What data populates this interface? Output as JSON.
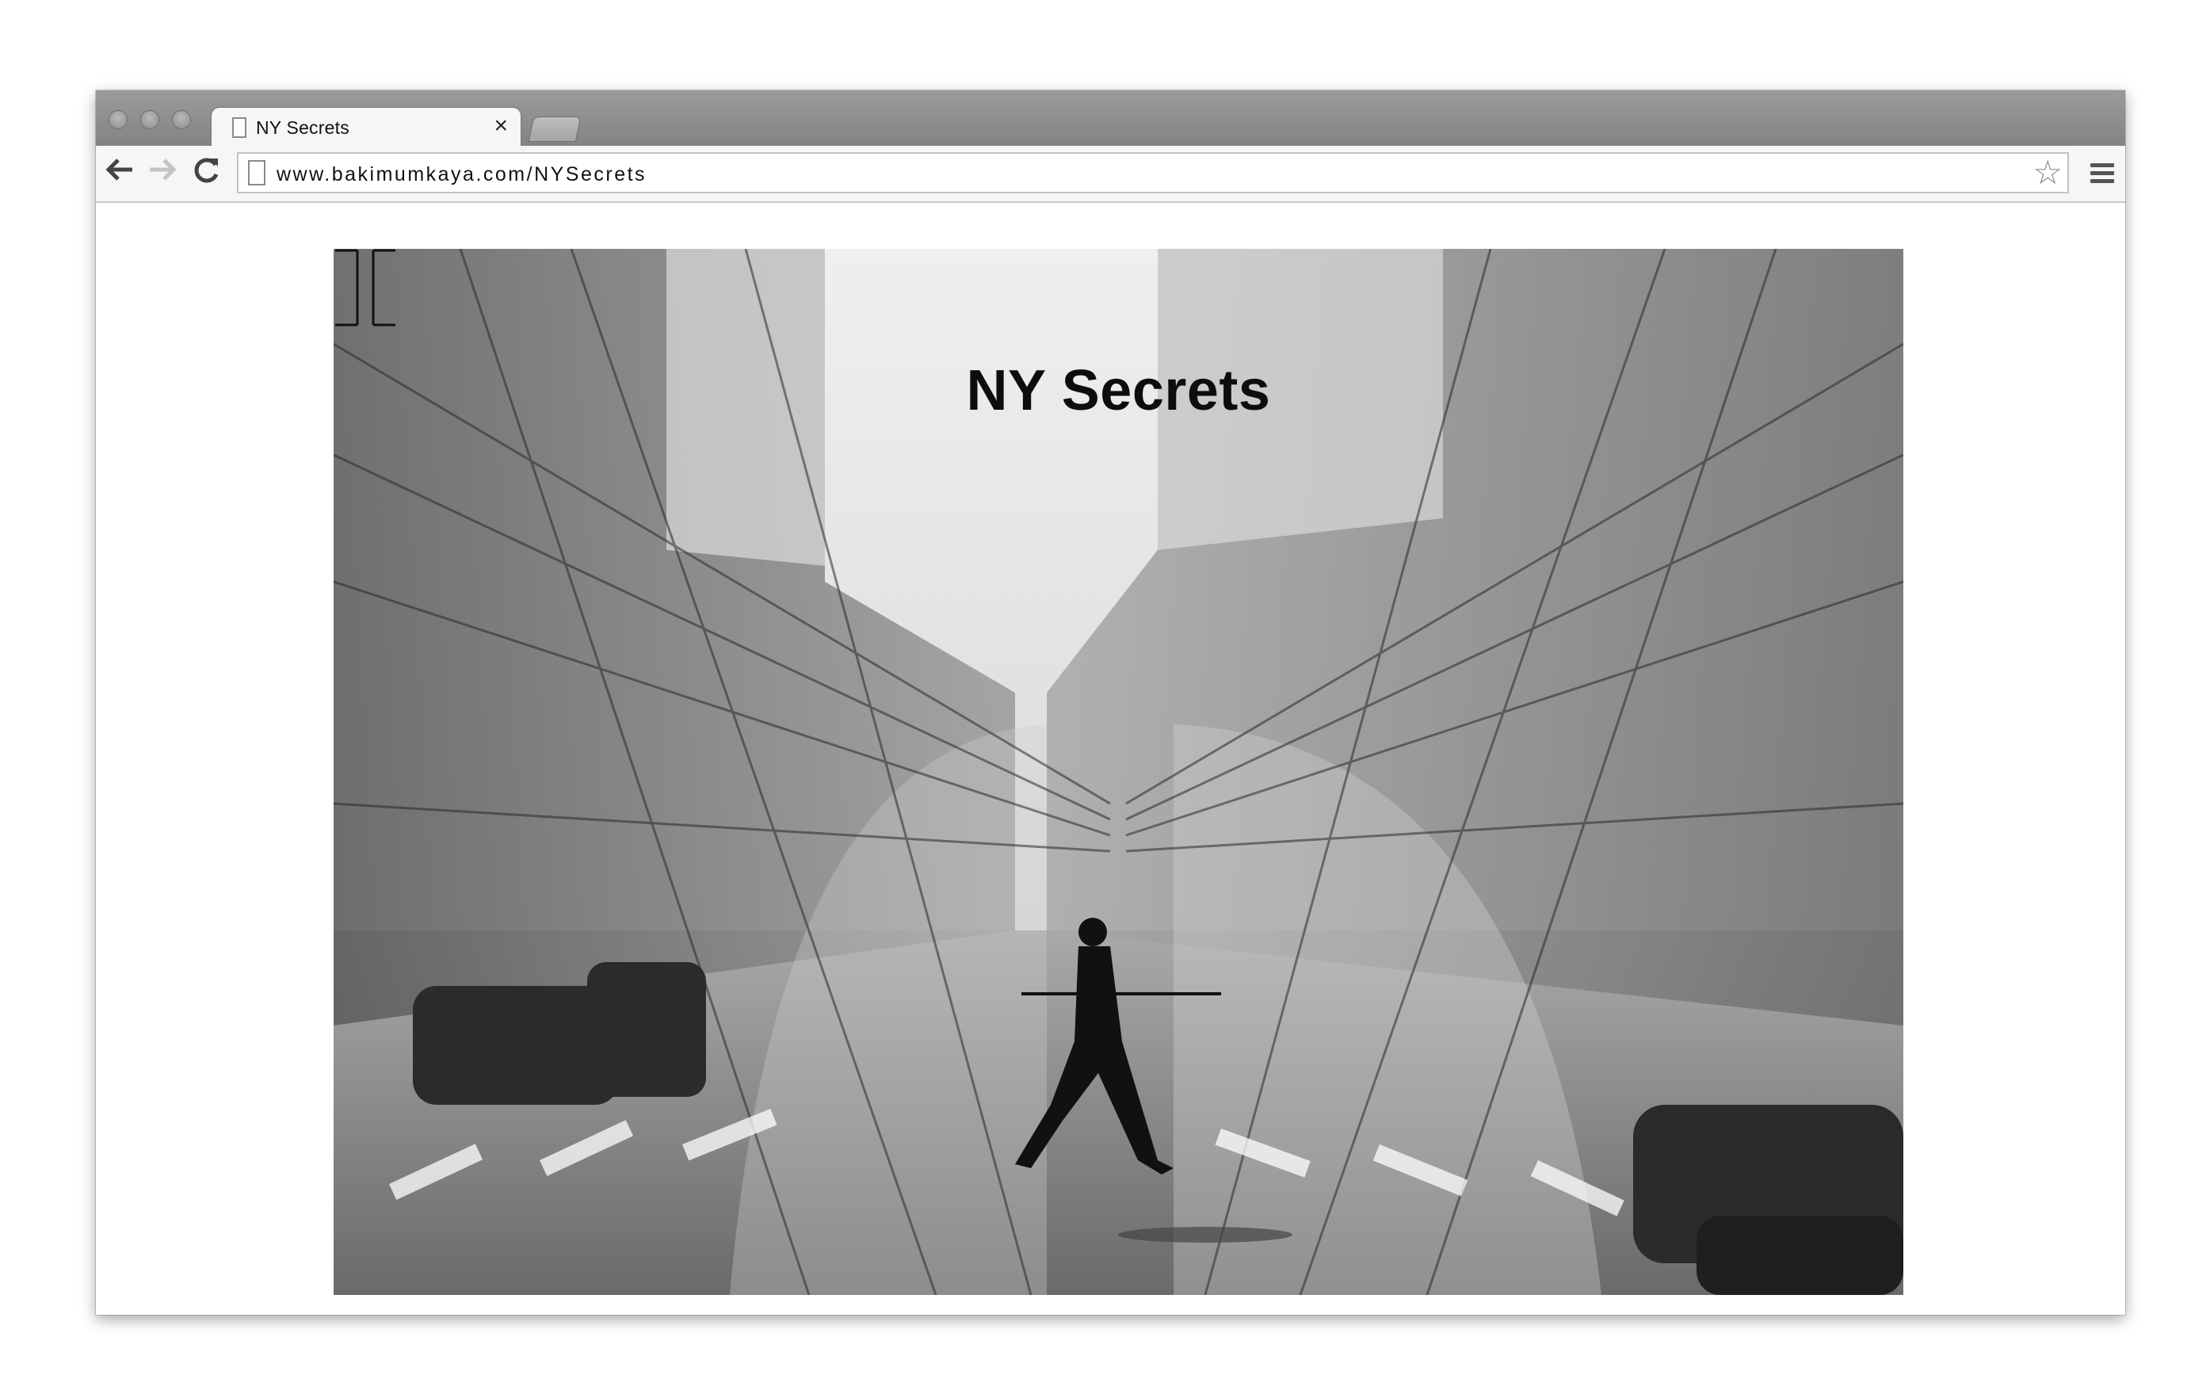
{
  "browser": {
    "tab": {
      "title": "NY Secrets",
      "close_symbol": "×"
    },
    "toolbar": {
      "back_icon": "back-arrow-icon",
      "forward_icon": "forward-arrow-icon",
      "reload_icon": "reload-icon",
      "url": "www.bakimumkaya.com/NYSecrets",
      "bookmark_icon": "star-icon",
      "menu_icon": "hamburger-menu-icon"
    }
  },
  "page": {
    "title": "NY Secrets",
    "hero_image": "black-and-white double-exposure New York street with pedestrian crossing",
    "cursor_icon": "text-cursor-icon"
  }
}
